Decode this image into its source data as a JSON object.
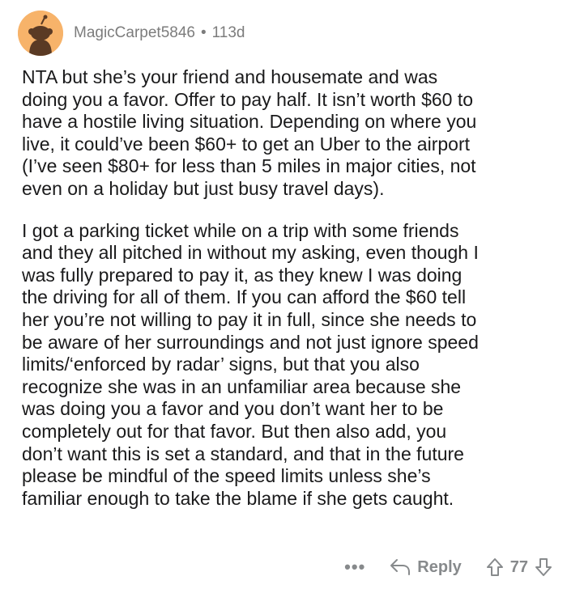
{
  "comment": {
    "author": "MagicCarpet5846",
    "separator": "•",
    "age": "113d",
    "paragraphs": [
      "NTA but she’s your friend and housemate and was\ndoing you a favor. Offer to pay half. It isn’t worth $60 to\nhave a hostile living situation. Depending on where you\nlive, it could’ve been $60+ to get an Uber to the airport\n(I’ve seen $80+ for less than 5 miles in major cities, not\neven on a holiday but just busy travel days).",
      "I got a parking ticket while on a trip with some friends\nand they all pitched in without my asking, even though I\nwas fully prepared to pay it, as they knew I was doing\nthe driving for all of them. If you can afford the $60 tell\nher you’re not willing to pay it in full, since she needs to\nbe aware of her surroundings and not just ignore speed\nlimits/‘enforced by radar’ signs, but that you also\nrecognize she was in an unfamiliar area because she\nwas doing you a favor and you don’t want her to be\ncompletely out for that favor. But then also add, you\ndon’t want this is set a standard, and that in the future\nplease be mindful of the speed limits unless she’s\nfamiliar enough to take the blame if she gets caught."
    ]
  },
  "actions": {
    "more": "•••",
    "reply_label": "Reply",
    "vote_count": "77"
  },
  "icons": {
    "avatar": "snoo-avatar-icon",
    "reply": "reply-arrow-icon",
    "upvote": "upvote-arrow-icon",
    "downvote": "downvote-arrow-icon"
  },
  "colors": {
    "avatar_bg": "#f7b36a",
    "meta_text": "#7c7c7c",
    "body_text": "#1a1a1b",
    "action_text": "#878a8c"
  }
}
